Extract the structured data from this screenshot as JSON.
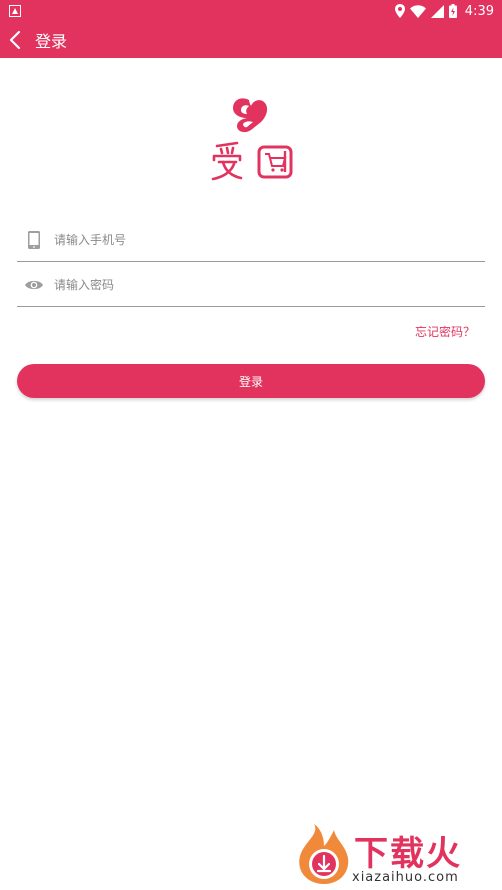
{
  "status_bar": {
    "time": "4:39",
    "icons": [
      "notification-icon",
      "location-icon",
      "wifi-icon",
      "signal-icon",
      "battery-icon"
    ]
  },
  "app_bar": {
    "title": "登录",
    "back_icon": "chevron-left-icon"
  },
  "logo": {
    "text": "爱团",
    "icon": "heart-logo-icon"
  },
  "form": {
    "phone": {
      "placeholder": "请输入手机号",
      "value": "",
      "icon": "phone-icon"
    },
    "password": {
      "placeholder": "请输入密码",
      "value": "",
      "icon": "eye-icon"
    },
    "forgot_label": "忘记密码？",
    "login_label": "登录"
  },
  "watermark": {
    "text": "下载火",
    "url": "xiazaihuo.com"
  },
  "colors": {
    "primary": "#e2335f",
    "divider": "#9a9a9a",
    "placeholder": "#8a8a8a"
  }
}
